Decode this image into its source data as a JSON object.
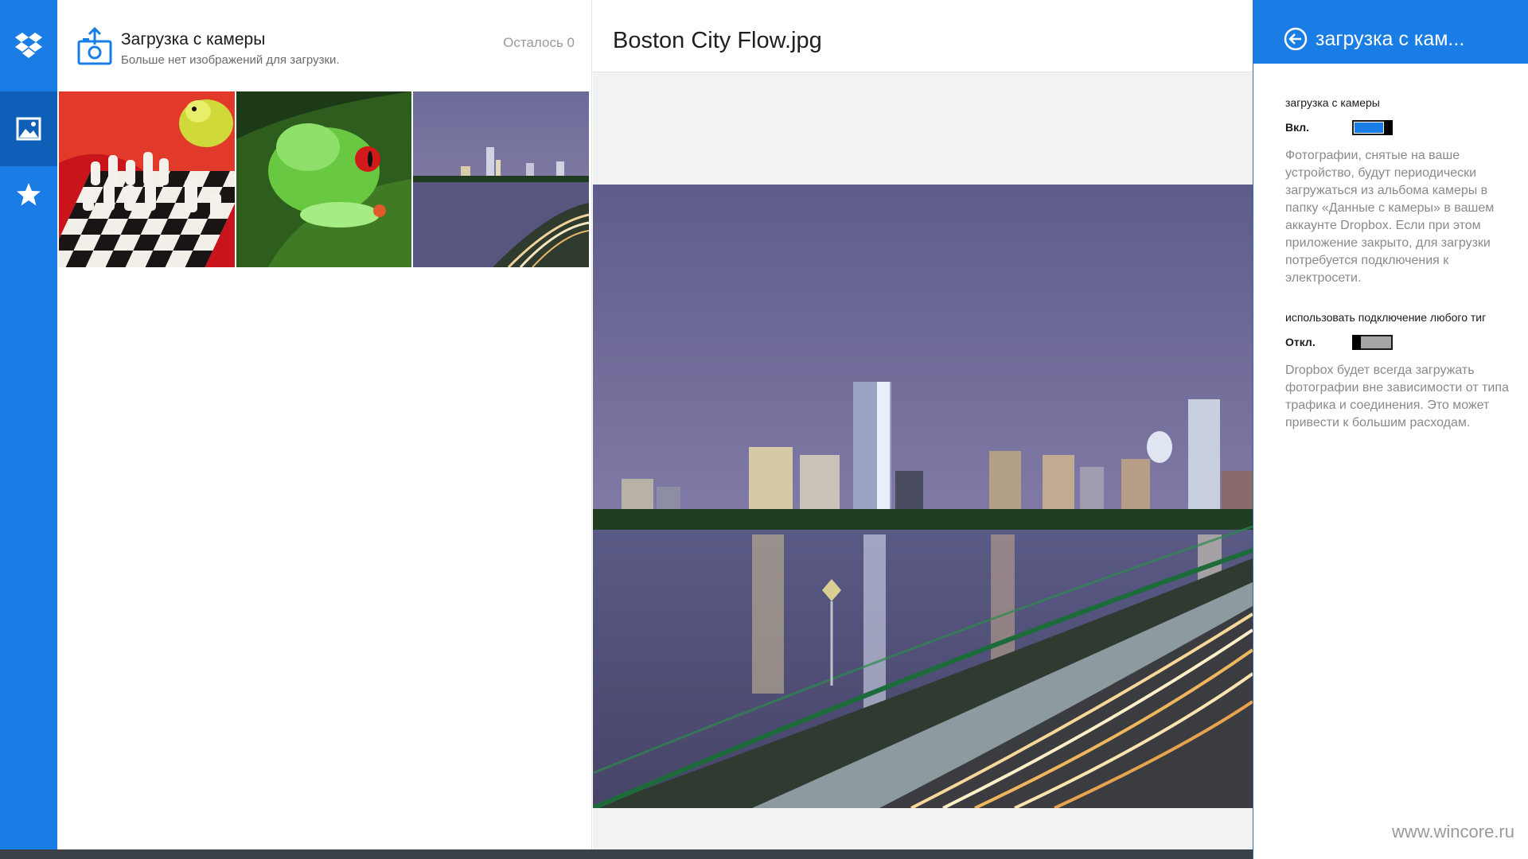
{
  "appbar": {
    "items": [
      {
        "icon": "dropbox-logo-icon",
        "active": false
      },
      {
        "icon": "photos-icon",
        "active": true
      },
      {
        "icon": "favorites-star-icon",
        "active": false
      }
    ]
  },
  "upload": {
    "title": "Загрузка с камеры",
    "subtitle": "Больше нет изображений для загрузки.",
    "remaining": "Осталось 0",
    "thumbnails": [
      {
        "subject": "chess-and-parrot"
      },
      {
        "subject": "green-frog"
      },
      {
        "subject": "boston-skyline"
      }
    ]
  },
  "preview": {
    "title": "Boston City Flow.jpg"
  },
  "settings": {
    "title": "загрузка с кам...",
    "camera_upload_label": "загрузка с камеры",
    "camera_upload_state": "Вкл.",
    "camera_upload_on": true,
    "camera_upload_desc": "Фотографии, снятые на ваше устройство, будут периодически загружаться из альбома камеры в папку «Данные с камеры» в вашем аккаунте Dropbox. Если при этом приложение закрыто, для загрузки потребуется подключения к электросети.",
    "any_connection_label": "использовать подключение любого тиг",
    "any_connection_state": "Откл.",
    "any_connection_on": false,
    "any_connection_desc": "Dropbox будет всегда загружать фотографии вне зависимости от типа трафика и соединения. Это может привести к большим расходам."
  },
  "watermark": "www.wincore.ru",
  "colors": {
    "accent": "#1a7de6",
    "appbar_active": "#0f5fb8",
    "bottom_bar": "#3b4149"
  }
}
